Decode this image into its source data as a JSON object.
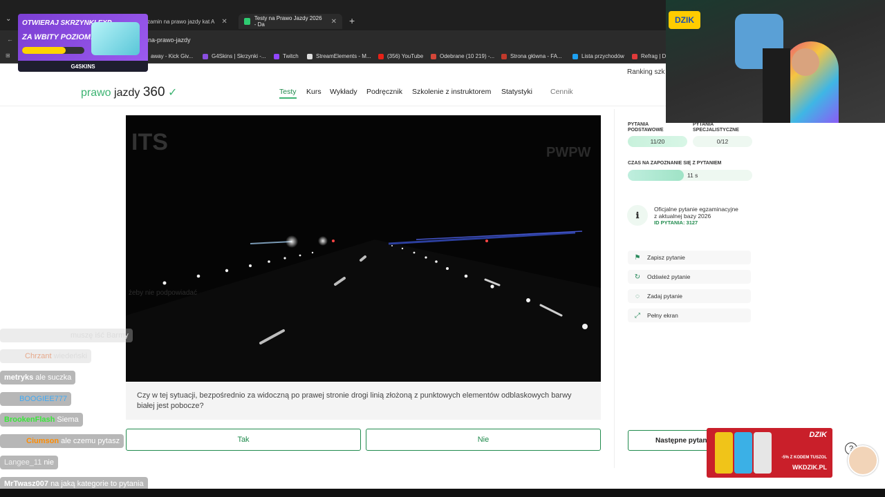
{
  "browser": {
    "tabs": [
      {
        "label": "zamin na prawo jazdy kat A",
        "active": false
      },
      {
        "label": "Testy na Prawo Jazdy 2026 - Da",
        "active": true
      }
    ],
    "url": "na-prawo-jazdy",
    "bookmarks": [
      "away - Kick Giv...",
      "G4Skins | Skrzynki -...",
      "Twitch",
      "StreamElements - M...",
      "(356) YouTube",
      "Odebrane (10 219) -...",
      "Strona główna - FA...",
      "Lista przychodów",
      "Refrag | D"
    ]
  },
  "page": {
    "top_link": "Ranking szk",
    "logo": {
      "text_a": "prawo",
      "text_b": "jazdy",
      "text_c": "360"
    },
    "nav": [
      "Testy",
      "Kurs",
      "Wykłady",
      "Podręcznik",
      "Szkolenie z instruktorem",
      "Statystyki",
      "Cennik"
    ],
    "video": {
      "watermark_left": "ITS",
      "watermark_right": "PWPW",
      "overlay_text": "żeby nie podpowiadać"
    },
    "question": "Czy w tej sytuacji, bezpośrednio za widoczną po prawej stronie drogi linią złożoną z punktowych elementów odblaskowych barwy białej jest pobocze?",
    "answers": {
      "yes": "Tak",
      "no": "Nie"
    },
    "sidebar": {
      "basic_label": "PYTANIA\nPODSTAWOWE",
      "basic_value": "11/20",
      "special_label": "PYTANIA\nSPECJALISTYCZNE",
      "special_value": "0/12",
      "timer_label": "CZAS NA ZAPOZNANIE SIĘ Z PYTANIEM",
      "timer_value": "11 s",
      "timer_fraction": 0.45,
      "info_line1": "Oficjalne pytanie egzaminacyjne",
      "info_line2": "z aktualnej bazy 2026",
      "info_id": "ID PYTANIA: 3127",
      "actions": [
        "Zapisz pytanie",
        "Odśwież pytanie",
        "Zadaj pytanie",
        "Pełny ekran"
      ],
      "next_button": "Następne pytan"
    }
  },
  "chat": [
    {
      "user": "",
      "msg": "muszę iść Barmy"
    },
    {
      "user": "Chrzant",
      "msg": "wiedeński"
    },
    {
      "user": "metryks",
      "msg": "ale suczka"
    },
    {
      "user": "BOOGIEE777",
      "msg": ""
    },
    {
      "user": "BrookenFlash",
      "msg": "Siema"
    },
    {
      "user": "Ciumson",
      "msg": "ale czemu pytasz"
    },
    {
      "user": "Langee_11",
      "msg": "nie"
    },
    {
      "user": "MrTwasz007",
      "msg": "na jaką kategorie to pytania"
    }
  ],
  "promo": {
    "line1": "OTWIERAJ SKRZYNKI EXP",
    "line2": "ZA WBITY POZIOM!",
    "brand": "G4SKINS"
  },
  "webcam": {
    "brand": "DZIK"
  },
  "ad": {
    "brand": "DZIK",
    "promo": "-5% Z KODEM TUSZOL",
    "url": "WKDZIK.PL"
  },
  "colors": {
    "accent": "#3cb371",
    "accent_dark": "#1f8a4c",
    "promo": "#7b3fd3",
    "ad": "#c91f2a"
  }
}
